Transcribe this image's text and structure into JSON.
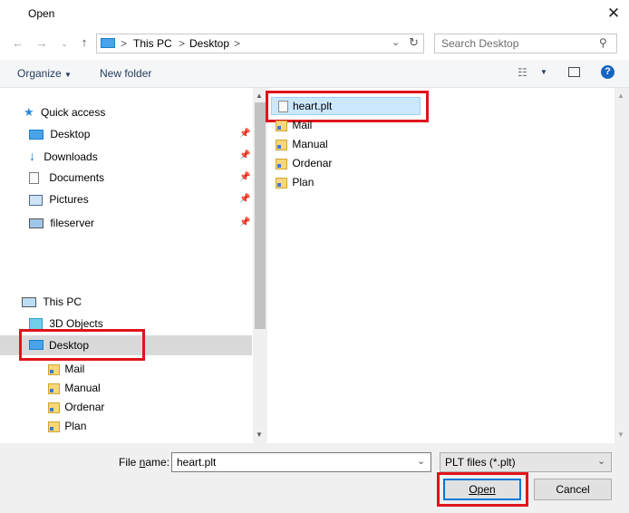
{
  "window": {
    "title": "Open"
  },
  "address": {
    "parts": [
      "This PC",
      "Desktop"
    ],
    "separator": ">"
  },
  "search": {
    "placeholder": "Search Desktop"
  },
  "toolbar": {
    "organize": "Organize",
    "new_folder": "New folder"
  },
  "quick_access": {
    "label": "Quick access",
    "items": [
      {
        "label": "Desktop",
        "icon": "desktop-icon"
      },
      {
        "label": "Downloads",
        "icon": "download-icon"
      },
      {
        "label": "Documents",
        "icon": "documents-icon"
      },
      {
        "label": "Pictures",
        "icon": "pictures-icon"
      },
      {
        "label": "fileserver",
        "icon": "network-drive-icon"
      }
    ]
  },
  "this_pc": {
    "label": "This PC",
    "items": [
      {
        "label": "3D Objects"
      },
      {
        "label": "Desktop",
        "selected": true
      }
    ],
    "desktop_children": [
      "Mail",
      "Manual",
      "Ordenar",
      "Plan"
    ]
  },
  "files": [
    {
      "name": "heart.plt",
      "type": "file",
      "selected": true
    },
    {
      "name": "Mail",
      "type": "folder"
    },
    {
      "name": "Manual",
      "type": "folder"
    },
    {
      "name": "Ordenar",
      "type": "folder"
    },
    {
      "name": "Plan",
      "type": "folder"
    }
  ],
  "filename": {
    "label_prefix": "File ",
    "label_underlined": "n",
    "label_suffix": "ame:",
    "value": "heart.plt"
  },
  "filetype": {
    "value": "PLT files (*.plt)"
  },
  "buttons": {
    "open": "Open",
    "cancel": "Cancel"
  },
  "colors": {
    "highlight": "#e0141c",
    "selection": "#cce8ff",
    "accent": "#0078d7"
  }
}
